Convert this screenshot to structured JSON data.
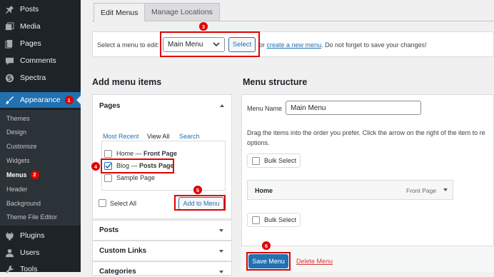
{
  "sidebar": {
    "items": [
      {
        "label": "Posts",
        "icon": "pushpin-icon"
      },
      {
        "label": "Media",
        "icon": "media-icon"
      },
      {
        "label": "Pages",
        "icon": "pages-icon"
      },
      {
        "label": "Comments",
        "icon": "comment-icon"
      },
      {
        "label": "Spectra",
        "icon": "spectra-icon"
      },
      {
        "label": "Appearance",
        "icon": "brush-icon",
        "badge": "1"
      },
      {
        "label": "Plugins",
        "icon": "plugin-icon"
      },
      {
        "label": "Users",
        "icon": "user-icon"
      },
      {
        "label": "Tools",
        "icon": "wrench-icon"
      }
    ],
    "submenu": [
      {
        "label": "Themes"
      },
      {
        "label": "Design"
      },
      {
        "label": "Customize"
      },
      {
        "label": "Widgets"
      },
      {
        "label": "Menus",
        "badge": "2"
      },
      {
        "label": "Header"
      },
      {
        "label": "Background"
      },
      {
        "label": "Theme File Editor"
      }
    ]
  },
  "tabs": {
    "edit": "Edit Menus",
    "manage": "Manage Locations"
  },
  "select_bar": {
    "prompt": "Select a menu to edit:",
    "selected_menu": "Main Menu",
    "button": "Select",
    "or": "or",
    "create_link": "create a new menu",
    "suffix": ". Do not forget to save your changes!"
  },
  "add_items": {
    "heading": "Add menu items",
    "pages_title": "Pages",
    "tabs": {
      "recent": "Most Recent",
      "all": "View All",
      "search": "Search"
    },
    "pages": [
      {
        "title": "Home",
        "sep": " — ",
        "tag": "Front Page",
        "checked": false
      },
      {
        "title": "Blog",
        "sep": " — ",
        "tag": "Posts Page",
        "checked": true
      },
      {
        "title": "Sample Page",
        "sep": "",
        "tag": "",
        "checked": false
      }
    ],
    "select_all": "Select All",
    "add_button": "Add to Menu",
    "sections": {
      "posts": "Posts",
      "custom_links": "Custom Links",
      "categories": "Categories"
    }
  },
  "structure": {
    "heading": "Menu structure",
    "name_label": "Menu Name",
    "name_value": "Main Menu",
    "instructions_1": "Drag the items into the order you prefer. Click the arrow on the right of the item to re",
    "instructions_2": "options.",
    "bulk_select": "Bulk Select",
    "item": {
      "title": "Home",
      "type": "Front Page"
    },
    "save_button": "Save Menu",
    "delete_link": "Delete Menu"
  },
  "steps": {
    "s3": "3",
    "s4": "4",
    "s5": "5",
    "s6": "6"
  },
  "colors": {
    "accent": "#2271b1",
    "sidebar_bg": "#1d2327",
    "annotation": "#e00000",
    "delete": "#d63638"
  }
}
